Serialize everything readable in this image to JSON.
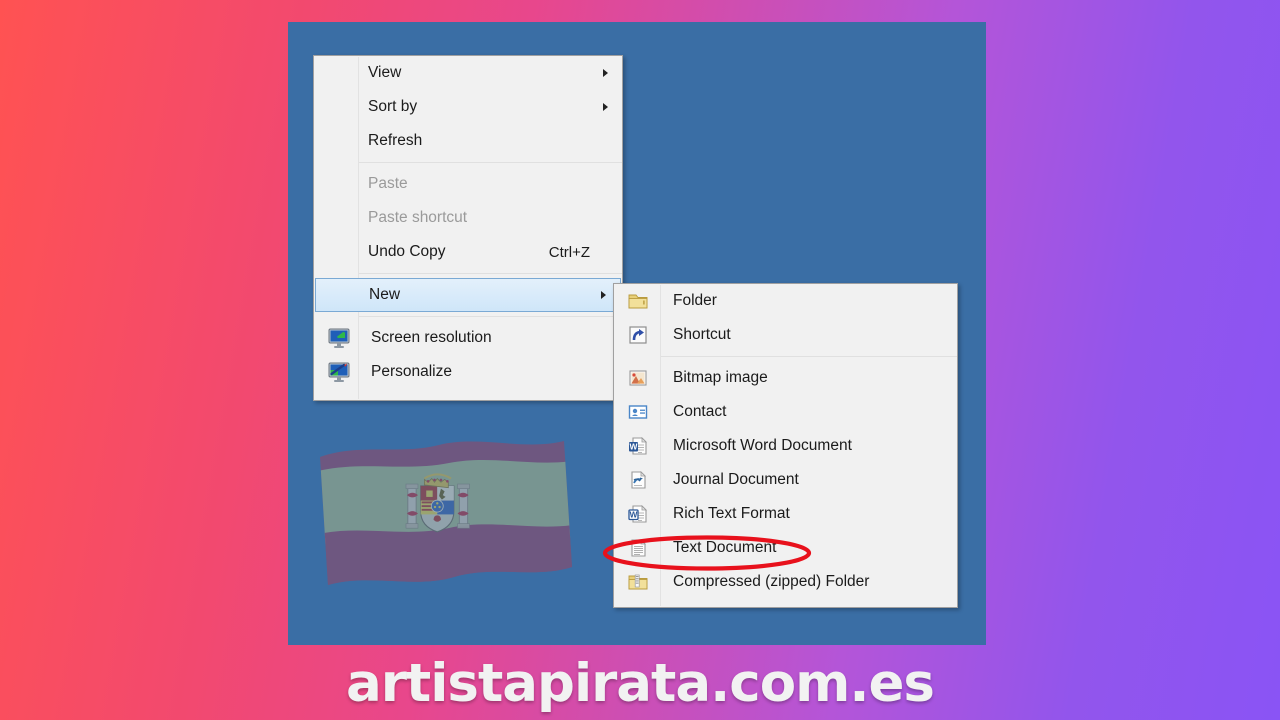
{
  "background": {
    "gradient_from": "#ff5252",
    "gradient_to": "#8a54f5",
    "desktop_color": "#3a6ea5"
  },
  "desktop": {
    "flag": {
      "name": "spain-waving-flag",
      "colors": {
        "band_top": "#8e4a6b",
        "band_middle": "#9fae85",
        "band_bottom": "#8e4a6b"
      }
    }
  },
  "context_menu": {
    "name": "desktop-context-menu",
    "items": [
      {
        "label": "View",
        "submenu": true,
        "disabled": false,
        "accel": "",
        "icon": ""
      },
      {
        "label": "Sort by",
        "submenu": true,
        "disabled": false,
        "accel": "",
        "icon": ""
      },
      {
        "label": "Refresh",
        "submenu": false,
        "disabled": false,
        "accel": "",
        "icon": ""
      },
      {
        "separator": true
      },
      {
        "label": "Paste",
        "submenu": false,
        "disabled": true,
        "accel": "",
        "icon": ""
      },
      {
        "label": "Paste shortcut",
        "submenu": false,
        "disabled": true,
        "accel": "",
        "icon": ""
      },
      {
        "label": "Undo Copy",
        "submenu": false,
        "disabled": false,
        "accel": "Ctrl+Z",
        "icon": ""
      },
      {
        "separator": true
      },
      {
        "label": "New",
        "submenu": true,
        "disabled": false,
        "accel": "",
        "icon": "",
        "highlighted": true
      },
      {
        "separator": true
      },
      {
        "label": "Screen resolution",
        "submenu": false,
        "disabled": false,
        "accel": "",
        "icon": "monitor-resolution-icon"
      },
      {
        "label": "Personalize",
        "submenu": false,
        "disabled": false,
        "accel": "",
        "icon": "monitor-personalize-icon"
      }
    ]
  },
  "new_submenu": {
    "name": "new-submenu",
    "items": [
      {
        "label": "Folder",
        "icon": "folder-icon"
      },
      {
        "label": "Shortcut",
        "icon": "shortcut-icon"
      },
      {
        "separator": true
      },
      {
        "label": "Bitmap image",
        "icon": "bitmap-image-icon"
      },
      {
        "label": "Contact",
        "icon": "contact-icon"
      },
      {
        "label": "Microsoft Word Document",
        "icon": "word-document-icon"
      },
      {
        "label": "Journal Document",
        "icon": "journal-document-icon"
      },
      {
        "label": "Rich Text Format",
        "icon": "rich-text-icon"
      },
      {
        "label": "Text Document",
        "icon": "text-document-icon",
        "annotated": true
      },
      {
        "label": "Compressed (zipped) Folder",
        "icon": "zipped-folder-icon"
      }
    ]
  },
  "annotation": {
    "name": "red-ellipse-highlight",
    "target": "Text Document",
    "color": "#e8111c"
  },
  "watermark": {
    "text": "artistapirata.com.es",
    "color": "#f2f2f2"
  }
}
